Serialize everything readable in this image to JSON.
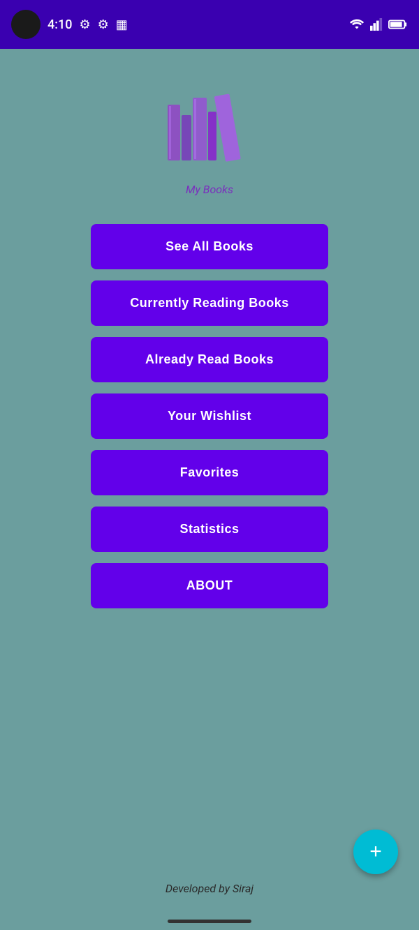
{
  "statusBar": {
    "time": "4:10",
    "backgroundColor": "#3a00b0"
  },
  "logo": {
    "altText": "My Books",
    "subtitle": "My Books"
  },
  "buttons": [
    {
      "id": "see-all",
      "label": "See All Books"
    },
    {
      "id": "currently-reading",
      "label": "Currently Reading Books"
    },
    {
      "id": "already-read",
      "label": "Already Read Books"
    },
    {
      "id": "wishlist",
      "label": "Your Wishlist"
    },
    {
      "id": "favorites",
      "label": "Favorites"
    },
    {
      "id": "statistics",
      "label": "Statistics"
    },
    {
      "id": "about",
      "label": "ABOUT"
    }
  ],
  "footer": {
    "credit": "Developed by Siraj"
  },
  "fab": {
    "label": "+"
  },
  "colors": {
    "background": "#6b9e9e",
    "statusBar": "#3a00b0",
    "buttonBg": "#6200ea",
    "fabBg": "#00bcd4",
    "logoColor": "#7b2fbe"
  }
}
